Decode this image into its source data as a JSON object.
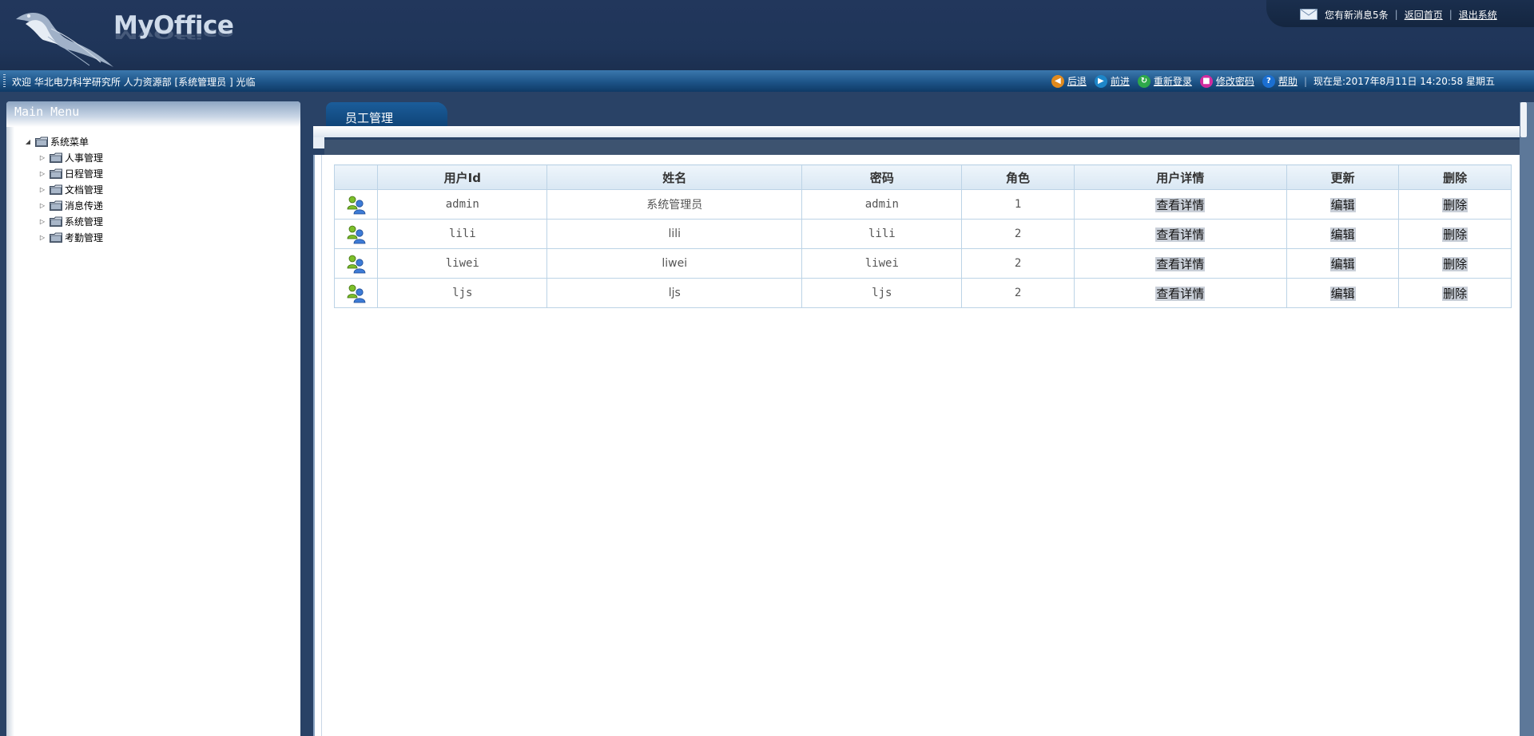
{
  "header": {
    "logo_text": "MyOffice",
    "messages_label": "您有新消息5条",
    "home_link": "返回首页",
    "logout_link": "退出系统"
  },
  "bar": {
    "welcome": "欢迎 华北电力科学研究所 人力资源部 [系统管理员 ] 光临",
    "nav": [
      {
        "label": "后退",
        "icon": "back-arrow-icon",
        "color": "#e08a1e"
      },
      {
        "label": "前进",
        "icon": "forward-arrow-icon",
        "color": "#1e86c8"
      },
      {
        "label": "重新登录",
        "icon": "relogin-icon",
        "color": "#2ea84a"
      },
      {
        "label": "修改密码",
        "icon": "lock-icon",
        "color": "#d22c9e"
      },
      {
        "label": "帮助",
        "icon": "help-icon",
        "color": "#1b6fd1"
      }
    ],
    "datetime": "现在是:2017年8月11日 14:20:58 星期五"
  },
  "sidebar": {
    "title": "Main Menu",
    "root": "系统菜单",
    "items": [
      "人事管理",
      "日程管理",
      "文档管理",
      "消息传递",
      "系统管理",
      "考勤管理"
    ]
  },
  "main": {
    "tab_label": "员工管理",
    "table": {
      "headers": [
        "",
        "用户Id",
        "姓名",
        "密码",
        "角色",
        "用户详情",
        "更新",
        "删除"
      ],
      "rows": [
        {
          "user_id": "admin",
          "name": "系统管理员",
          "password": "admin",
          "role": "1",
          "detail": "查看详情",
          "edit": "编辑",
          "delete": "删除"
        },
        {
          "user_id": "lili",
          "name": "lili",
          "password": "lili",
          "role": "2",
          "detail": "查看详情",
          "edit": "编辑",
          "delete": "删除"
        },
        {
          "user_id": "liwei",
          "name": "liwei",
          "password": "liwei",
          "role": "2",
          "detail": "查看详情",
          "edit": "编辑",
          "delete": "删除"
        },
        {
          "user_id": "ljs",
          "name": "ljs",
          "password": "ljs",
          "role": "2",
          "detail": "查看详情",
          "edit": "编辑",
          "delete": "删除"
        }
      ]
    }
  }
}
